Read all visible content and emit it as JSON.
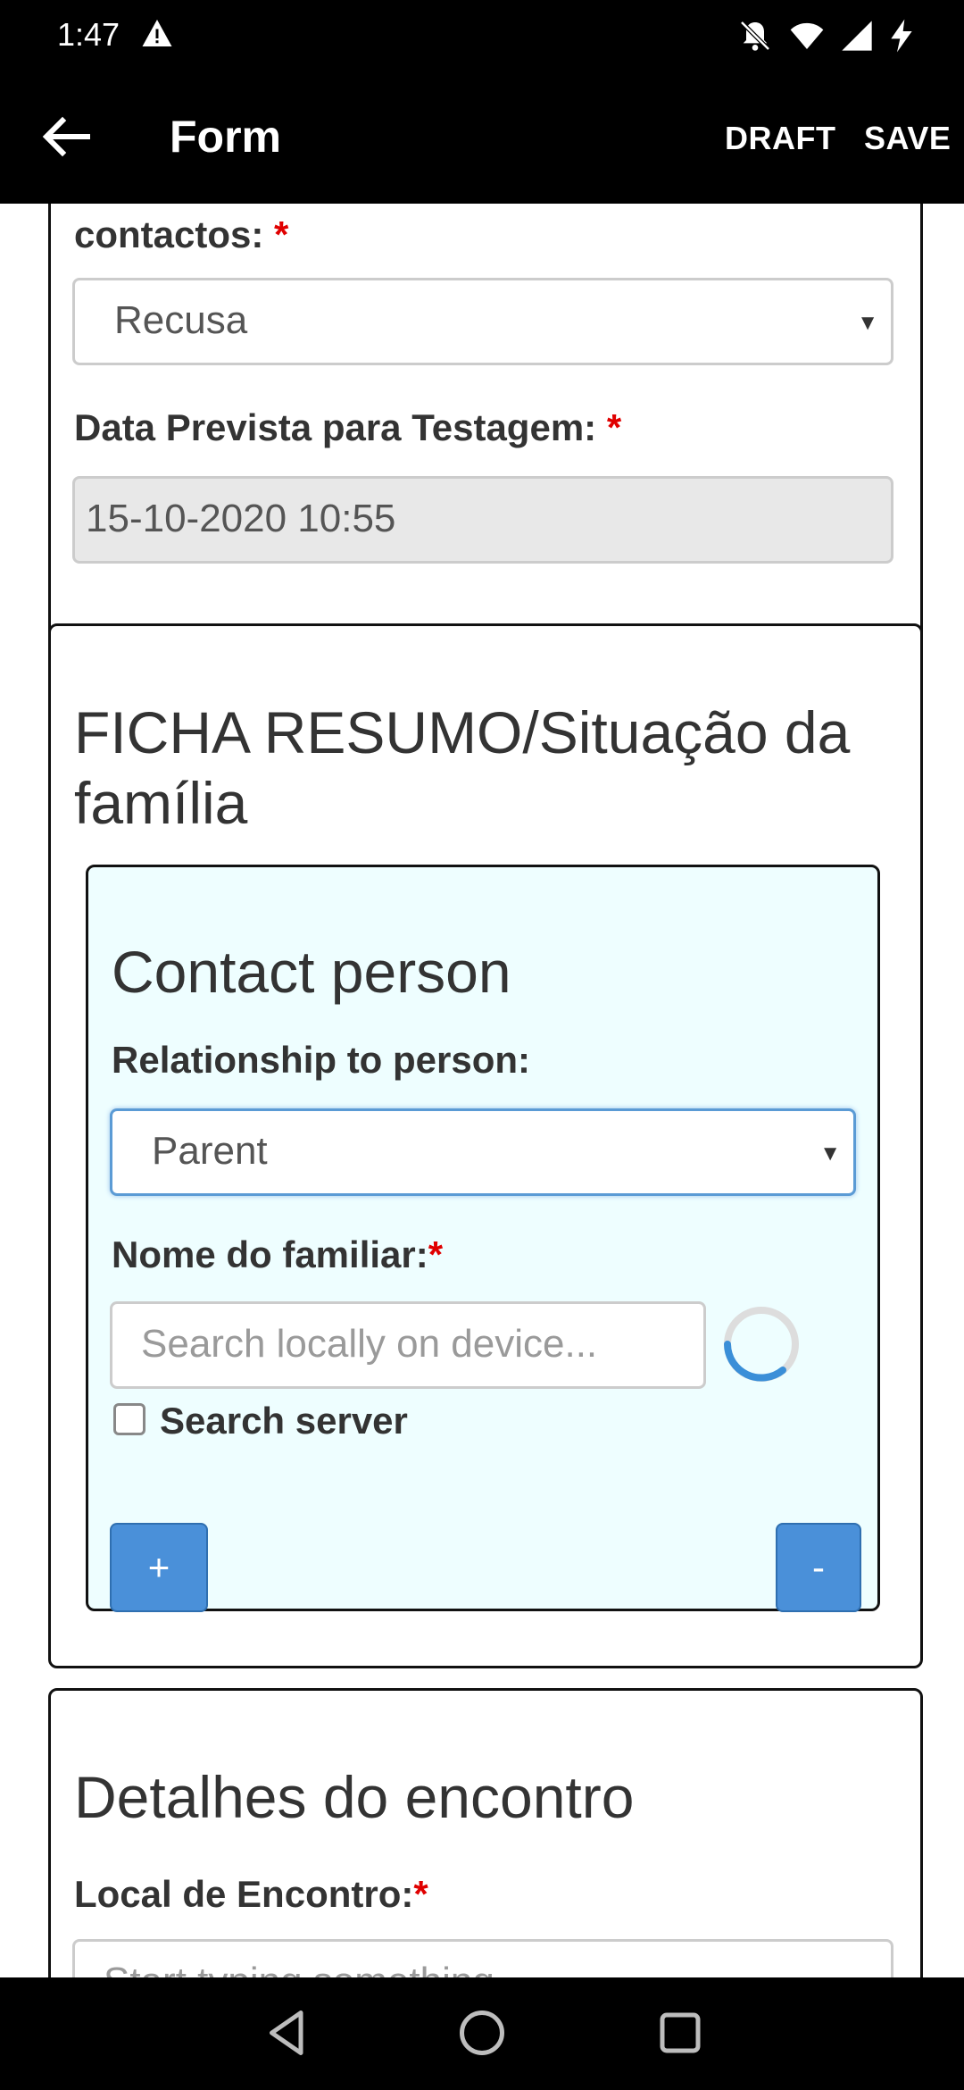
{
  "status_bar": {
    "time": "1:47",
    "icons": [
      "warning-icon",
      "do-not-disturb-icon",
      "wifi-icon",
      "signal-icon",
      "battery-charging-icon"
    ]
  },
  "app_bar": {
    "title": "Form",
    "draft_label": "DRAFT",
    "save_label": "SAVE"
  },
  "section1": {
    "partial_label": "contactos:",
    "required_mark": "*",
    "contact_select_value": "Recusa",
    "test_date_label": "Data Prevista para Testagem:",
    "test_date_value": "15-10-2020 10:55"
  },
  "section2": {
    "heading": "FICHA RESUMO/Situação da família",
    "contact_person": {
      "heading": "Contact person",
      "relationship_label": "Relationship to person:",
      "relationship_value": "Parent",
      "family_name_label": "Nome do familiar:",
      "required_mark": "*",
      "search_placeholder": "Search locally on device...",
      "search_server_label": "Search server",
      "search_server_checked": false,
      "add_label": "+",
      "remove_label": "-"
    }
  },
  "section3": {
    "heading": "Detalhes do encontro",
    "location_label": "Local de Encontro:",
    "required_mark": "*",
    "location_placeholder": "Start typing something"
  },
  "colors": {
    "bar_background": "#000000",
    "button_blue": "#4a90d9",
    "inner_card_bg": "#eefeff",
    "required_red": "#e00000",
    "focus_blue": "#5b9bd5"
  }
}
